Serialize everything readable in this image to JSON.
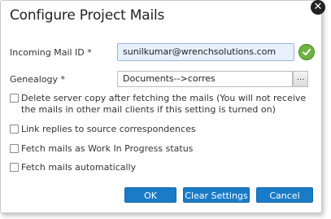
{
  "dialog": {
    "title": "Configure Project Mails",
    "close_glyph": "✕"
  },
  "fields": {
    "incoming_mail_label": "Incoming Mail ID *",
    "incoming_mail_value": "sunilkumar@wrenchsolutions.com",
    "genealogy_label": "Genealogy *",
    "genealogy_value": "Documents-->corres",
    "browse_label": "..."
  },
  "options": [
    {
      "label": "Delete server copy after fetching the mails (You will not receive the mails in other mail clients if this setting is turned on)",
      "checked": false
    },
    {
      "label": "Link replies to source correspondences",
      "checked": false
    },
    {
      "label": "Fetch mails as Work In Progress status",
      "checked": false
    },
    {
      "label": "Fetch mails automatically",
      "checked": false
    }
  ],
  "buttons": {
    "ok": "OK",
    "clear": "Clear Settings",
    "cancel": "Cancel"
  },
  "colors": {
    "primary_button": "#1a7bc7",
    "valid_icon": "#6cb33f"
  }
}
